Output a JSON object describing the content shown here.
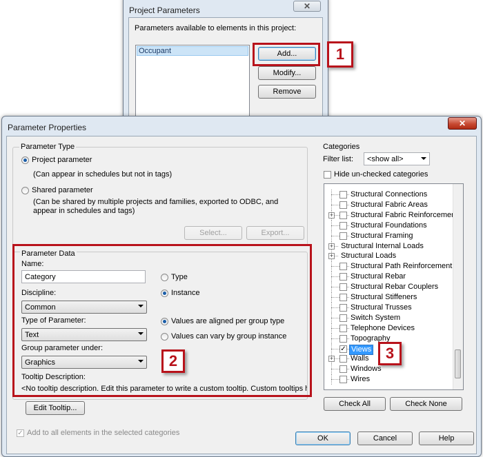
{
  "project_parameters": {
    "title": "Project Parameters",
    "prompt": "Parameters available to elements in this project:",
    "list_items": [
      "Occupant"
    ],
    "buttons": {
      "add": "Add...",
      "modify": "Modify...",
      "remove": "Remove"
    }
  },
  "parameter_properties": {
    "title": "Parameter Properties",
    "parameter_type": {
      "label": "Parameter Type",
      "project_parameter": "Project parameter",
      "project_parameter_note": "(Can appear in schedules but not in tags)",
      "shared_parameter": "Shared parameter",
      "shared_parameter_note_1": "(Can be shared by multiple projects and families, exported to ODBC, and",
      "shared_parameter_note_2": "appear in schedules and tags)",
      "select_button": "Select...",
      "export_button": "Export...",
      "selected": "project"
    },
    "parameter_data": {
      "label": "Parameter Data",
      "name_label": "Name:",
      "name_value": "Category",
      "discipline_label": "Discipline:",
      "discipline_value": "Common",
      "type_label": "Type of Parameter:",
      "type_value": "Text",
      "group_label": "Group parameter under:",
      "group_value": "Graphics",
      "radio_type": "Type",
      "radio_instance": "Instance",
      "radio_aligned": "Values are aligned per group type",
      "radio_vary": "Values can vary by group instance",
      "tooltip_label": "Tooltip Description:",
      "tooltip_text": "<No tooltip description. Edit this parameter to write a custom tooltip. Custom tooltips hav..."
    },
    "edit_tooltip_button": "Edit Tooltip...",
    "add_all_checkbox": "Add to all elements in the selected categories",
    "categories": {
      "label": "Categories",
      "filter_label": "Filter list:",
      "filter_value": "<show all>",
      "hide_unchecked": "Hide un-checked categories",
      "items": [
        {
          "label": "Structural Connections",
          "checked": false,
          "level": 1,
          "expander": false
        },
        {
          "label": "Structural Fabric Areas",
          "checked": false,
          "level": 1,
          "expander": false
        },
        {
          "label": "Structural Fabric Reinforcement",
          "checked": false,
          "level": 1,
          "expander": true
        },
        {
          "label": "Structural Foundations",
          "checked": false,
          "level": 1,
          "expander": false
        },
        {
          "label": "Structural Framing",
          "checked": false,
          "level": 1,
          "expander": false
        },
        {
          "label": "Structural Internal Loads",
          "checked": false,
          "level": 0,
          "expander": true
        },
        {
          "label": "Structural Loads",
          "checked": false,
          "level": 0,
          "expander": true
        },
        {
          "label": "Structural Path Reinforcement",
          "checked": false,
          "level": 1,
          "expander": false
        },
        {
          "label": "Structural Rebar",
          "checked": false,
          "level": 1,
          "expander": false
        },
        {
          "label": "Structural Rebar Couplers",
          "checked": false,
          "level": 1,
          "expander": false
        },
        {
          "label": "Structural Stiffeners",
          "checked": false,
          "level": 1,
          "expander": false
        },
        {
          "label": "Structural Trusses",
          "checked": false,
          "level": 1,
          "expander": false
        },
        {
          "label": "Switch System",
          "checked": false,
          "level": 1,
          "expander": false
        },
        {
          "label": "Telephone Devices",
          "checked": false,
          "level": 1,
          "expander": false
        },
        {
          "label": "Topography",
          "checked": false,
          "level": 1,
          "expander": false
        },
        {
          "label": "Views",
          "checked": true,
          "level": 1,
          "expander": false,
          "selected": true
        },
        {
          "label": "Walls",
          "checked": false,
          "level": 1,
          "expander": true
        },
        {
          "label": "Windows",
          "checked": false,
          "level": 1,
          "expander": false
        },
        {
          "label": "Wires",
          "checked": false,
          "level": 1,
          "expander": false
        }
      ],
      "check_all": "Check All",
      "check_none": "Check None"
    },
    "buttons": {
      "ok": "OK",
      "cancel": "Cancel",
      "help": "Help"
    }
  },
  "callouts": [
    "1",
    "2",
    "3"
  ],
  "colors": {
    "callout_red": "#b8121b",
    "selection_blue": "#3399ff"
  }
}
